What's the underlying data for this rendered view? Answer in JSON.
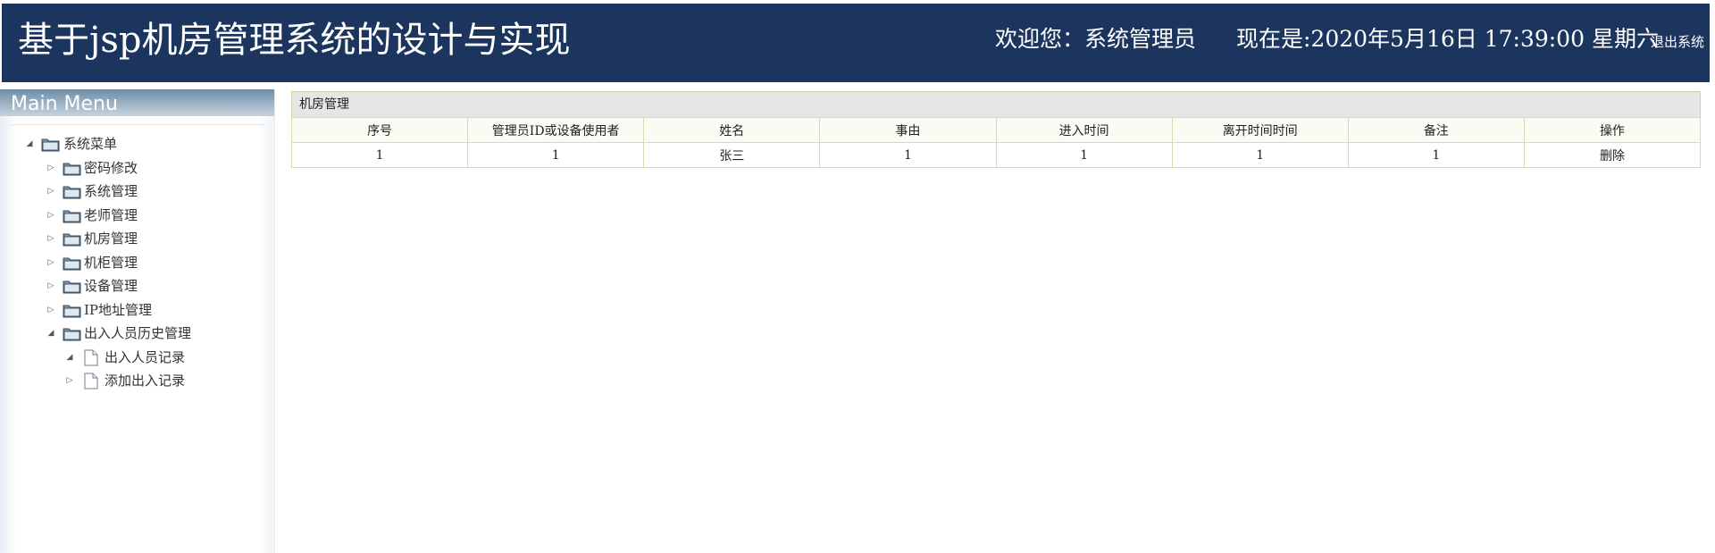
{
  "header": {
    "title": "基于jsp机房管理系统的设计与实现",
    "welcome": "欢迎您：系统管理员",
    "datetime": "现在是:2020年5月16日 17:39:00 星期六",
    "logout": "退出系统"
  },
  "sidebar": {
    "heading": "Main Menu",
    "root": {
      "label": "系统菜单",
      "expanded": true
    },
    "groups": [
      {
        "label": "密码修改",
        "expanded": false
      },
      {
        "label": "系统管理",
        "expanded": false
      },
      {
        "label": "老师管理",
        "expanded": false
      },
      {
        "label": "机房管理",
        "expanded": false
      },
      {
        "label": "机柜管理",
        "expanded": false
      },
      {
        "label": "设备管理",
        "expanded": false
      },
      {
        "label": "IP地址管理",
        "expanded": false
      },
      {
        "label": "出入人员历史管理",
        "expanded": true
      }
    ],
    "children": [
      {
        "label": "出入人员记录",
        "expanded": true
      },
      {
        "label": "添加出入记录",
        "expanded": false
      }
    ]
  },
  "main": {
    "panel_title": "机房管理",
    "columns": [
      "序号",
      "管理员ID或设备使用者",
      "姓名",
      "事由",
      "进入时间",
      "离开时间时间",
      "备注",
      "操作"
    ],
    "rows": [
      {
        "id": "1",
        "admin": "1",
        "name": "张三",
        "reason": "1",
        "enter_time": "1",
        "leave_time": "1",
        "note": "1",
        "action": "删除"
      }
    ]
  },
  "colors": {
    "header_bg": "#1c355e",
    "table_border": "#d3dcb4"
  }
}
